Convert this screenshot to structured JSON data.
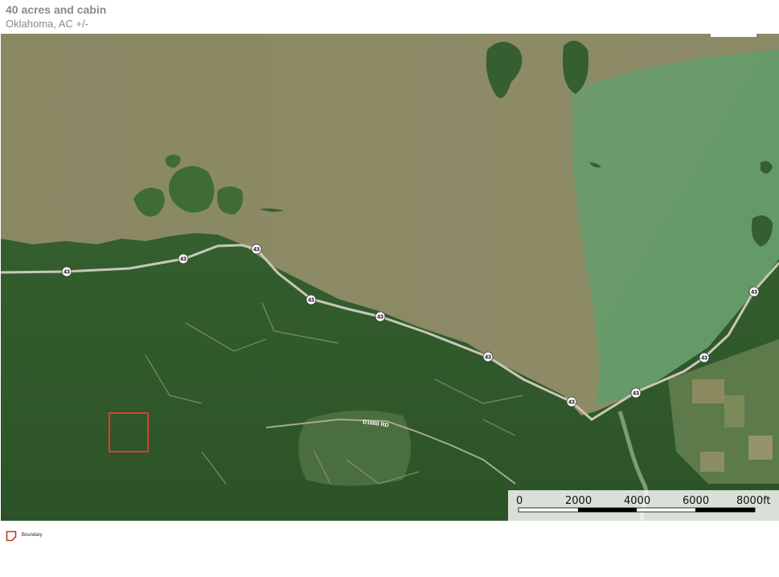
{
  "header": {
    "title": "40 acres and cabin",
    "subtitle": "Oklahoma,  AC +/-"
  },
  "map": {
    "road_shield_label": "43",
    "road_label": "D1660 RD",
    "colors": {
      "water_main": "#8e8c65",
      "water_green": "#6e9f72",
      "forest": "#2f5a2a",
      "boundary": "#e63a2e"
    }
  },
  "scalebar": {
    "ticks": [
      "0",
      "2000",
      "4000",
      "6000",
      "8000ft"
    ]
  },
  "legend": {
    "items": [
      {
        "label": "Boundary",
        "icon": "boundary-polygon-icon",
        "color": "#c9342b"
      }
    ]
  }
}
